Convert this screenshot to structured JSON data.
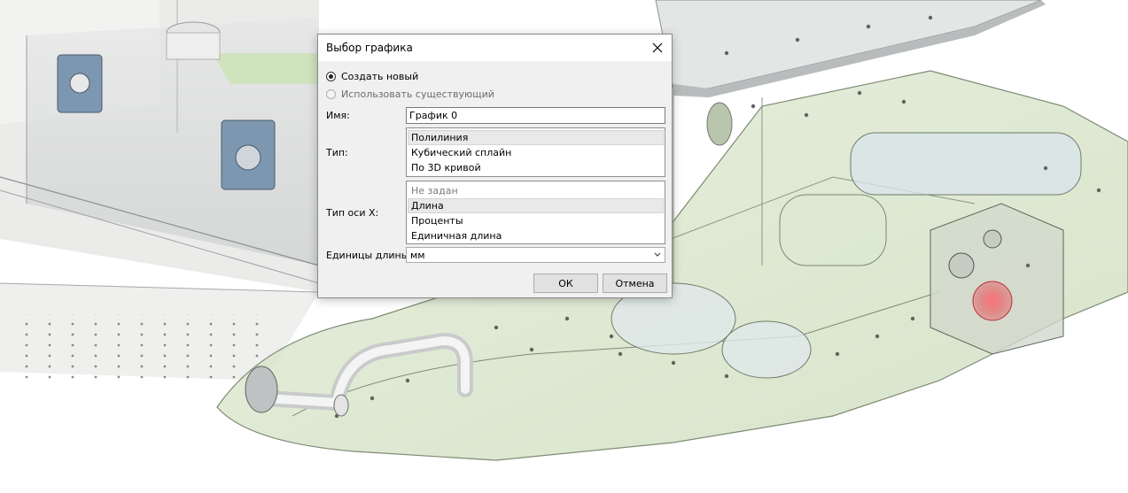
{
  "dialog": {
    "title": "Выбор графика",
    "radio_options": [
      {
        "label": "Создать новый",
        "checked": true,
        "enabled": true
      },
      {
        "label": "Использовать существующий",
        "checked": false,
        "enabled": false
      }
    ],
    "name_label": "Имя:",
    "name_value": "График 0",
    "type_label": "Тип:",
    "type_options": [
      {
        "label": "Полилиния",
        "selected": true
      },
      {
        "label": "Кубический сплайн",
        "selected": false
      },
      {
        "label": "По 3D кривой",
        "selected": false
      }
    ],
    "axis_label": "Тип оси X:",
    "axis_options": [
      {
        "label": "Не задан",
        "selected": false,
        "enabled": false
      },
      {
        "label": "Длина",
        "selected": true,
        "enabled": true
      },
      {
        "label": "Проценты",
        "selected": false,
        "enabled": true
      },
      {
        "label": "Единичная длина",
        "selected": false,
        "enabled": true
      }
    ],
    "units_label": "Единицы длины:",
    "units_value": "мм",
    "ok_label": "ОК",
    "cancel_label": "Отмена"
  },
  "icons": {
    "close": "close-icon",
    "dropdown": "chevron-down-icon"
  },
  "colors": {
    "highlight": "#e03a44",
    "model_green": "#cfe3bf",
    "sheet_metal": "#d9dcdc"
  }
}
